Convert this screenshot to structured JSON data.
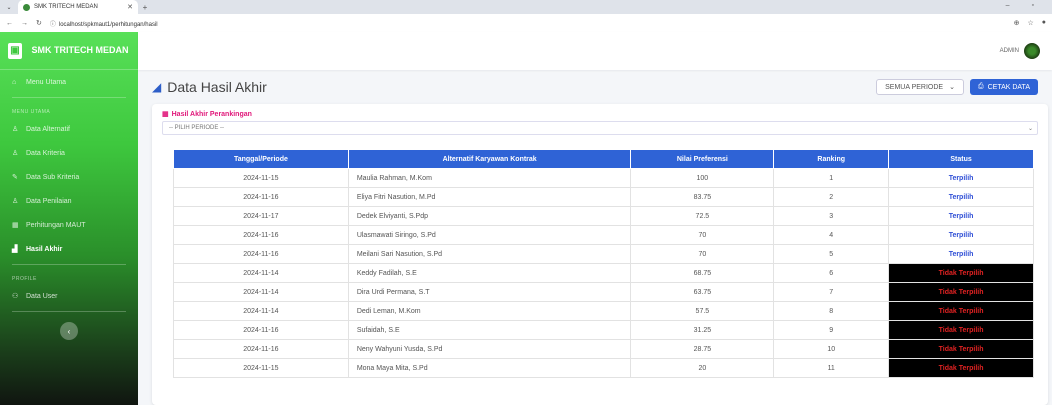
{
  "browser": {
    "tab_title": "SMK TRITECH MEDAN",
    "url": "localhost/spkmaut1/perhitungan/hasil"
  },
  "sidebar": {
    "brand": "SMK TRITECH MEDAN",
    "menu_utama": "Menu Utama",
    "section_master": "MENU UTAMA",
    "items": [
      {
        "label": "Data Alternatif",
        "icon": "user-icon"
      },
      {
        "label": "Data Kriteria",
        "icon": "user-icon"
      },
      {
        "label": "Data Sub Kriteria",
        "icon": "edit-icon"
      },
      {
        "label": "Data Penilaian",
        "icon": "user-icon"
      },
      {
        "label": "Perhitungan MAUT",
        "icon": "calculator-icon"
      },
      {
        "label": "Hasil Akhir",
        "icon": "chart-icon"
      }
    ],
    "section_profile": "PROFILE",
    "data_user": "Data User"
  },
  "topbar": {
    "user": "ADMIN"
  },
  "page": {
    "title": "Data Hasil Akhir",
    "periode_select": "SEMUA PERIODE",
    "print_button": "CETAK DATA"
  },
  "card": {
    "title": "Hasil Akhir Perankingan",
    "filter_placeholder": "-- PILIH PERIODE --"
  },
  "table": {
    "headers": [
      "Tanggal/Periode",
      "Alternatif Karyawan Kontrak",
      "Nilai Preferensi",
      "Ranking",
      "Status"
    ],
    "rows": [
      [
        "2024-11-15",
        "Maulia Rahman, M.Kom",
        "100",
        "1",
        "Terpilih"
      ],
      [
        "2024-11-16",
        "Eliya Fitri Nasution, M.Pd",
        "83.75",
        "2",
        "Terpilih"
      ],
      [
        "2024-11-17",
        "Dedek Elviyanti, S.Pdp",
        "72.5",
        "3",
        "Terpilih"
      ],
      [
        "2024-11-16",
        "Ulasmawati Siringo, S.Pd",
        "70",
        "4",
        "Terpilih"
      ],
      [
        "2024-11-16",
        "Meilani Sari Nasution, S.Pd",
        "70",
        "5",
        "Terpilih"
      ],
      [
        "2024-11-14",
        "Keddy Fadilah, S.E",
        "68.75",
        "6",
        "Tidak Terpilih"
      ],
      [
        "2024-11-14",
        "Dira Urdi Permana, S.T",
        "63.75",
        "7",
        "Tidak Terpilih"
      ],
      [
        "2024-11-14",
        "Dedi Leman, M.Kom",
        "57.5",
        "8",
        "Tidak Terpilih"
      ],
      [
        "2024-11-16",
        "Sufaidah, S.E",
        "31.25",
        "9",
        "Tidak Terpilih"
      ],
      [
        "2024-11-16",
        "Neny Wahyuni Yusda, S.Pd",
        "28.75",
        "10",
        "Tidak Terpilih"
      ],
      [
        "2024-11-15",
        "Mona Maya Mita, S.Pd",
        "20",
        "11",
        "Tidak Terpilih"
      ]
    ]
  }
}
